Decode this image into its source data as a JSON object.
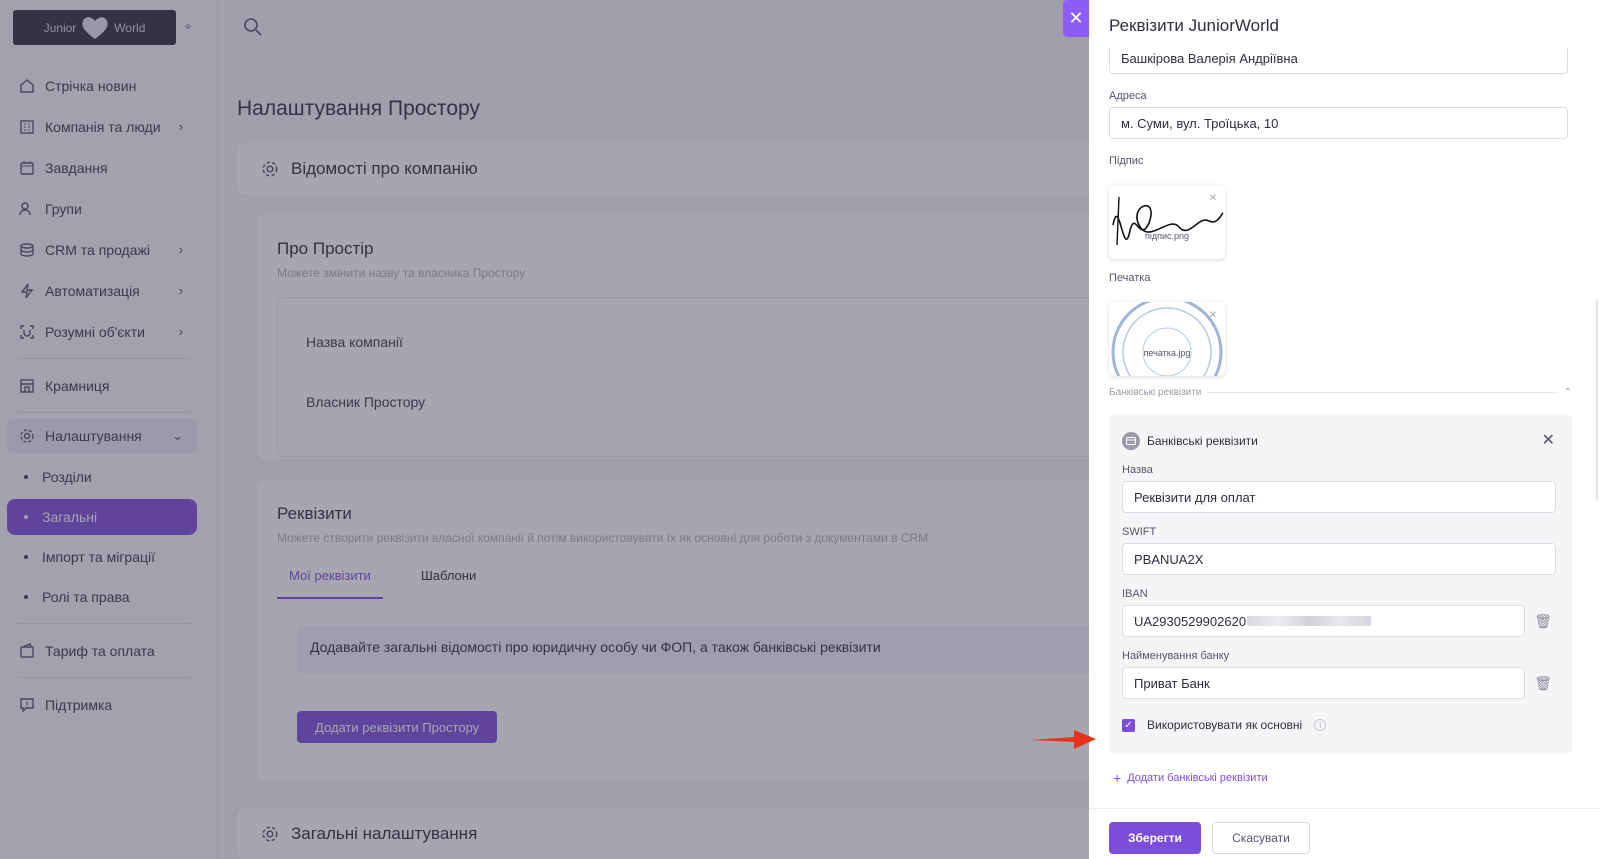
{
  "logo": {
    "left": "Junior",
    "right": "World"
  },
  "sidebar": {
    "items": [
      {
        "label": "Стрічка новин",
        "icon": "home-icon"
      },
      {
        "label": "Компанія та люди",
        "icon": "building-icon",
        "chevron": true
      },
      {
        "label": "Завдання",
        "icon": "calendar-icon"
      },
      {
        "label": "Групи",
        "icon": "users-icon"
      },
      {
        "label": "CRM та продажі",
        "icon": "database-icon",
        "chevron": true
      },
      {
        "label": "Автоматизація",
        "icon": "lightning-icon",
        "chevron": true
      },
      {
        "label": "Розумні об'єкти",
        "icon": "smart-object-icon",
        "chevron": true
      },
      {
        "label": "Крамниця",
        "icon": "store-icon"
      },
      {
        "label": "Налаштування",
        "icon": "gear-icon"
      }
    ],
    "sub_items": [
      "Розділи",
      "Загальні",
      "Імпорт та міграції",
      "Ролі та права"
    ],
    "bottom_items": [
      {
        "label": "Тариф та оплата",
        "icon": "wallet-icon"
      },
      {
        "label": "Підтримка",
        "icon": "support-icon"
      }
    ]
  },
  "main": {
    "page_title": "Налаштування Простору",
    "company_section": "Відомості про компанію",
    "about": {
      "title": "Про Простір",
      "subtitle": "Можете змінити назву та власника Простору",
      "name_label": "Назва компанії",
      "owner_label": "Власник Простору"
    },
    "requisites": {
      "title": "Реквізити",
      "subtitle": "Можете створити реквізити власної компанії й потім використовувати їх як основні для роботи з документами в CRM",
      "tab_mine": "Мої реквізити",
      "tab_templates": "Шаблони",
      "info": "Додавайте загальні відомості про юридичну особу чи ФОП, а також банківські реквізити",
      "add_button": "Додати реквізити Простору"
    },
    "general_section": "Загальні налаштування"
  },
  "drawer": {
    "title": "Реквізити JuniorWorld",
    "person_value": "Башкірова Валерія Андріївна",
    "address_label": "Адреса",
    "address_value": "м. Суми, вул. Троїцька, 10",
    "signature_label": "Підпис",
    "signature_file": "підпис.png",
    "stamp_label": "Печатка",
    "stamp_file": "печатка.jpg",
    "bank_section": "Банківські реквізити",
    "bank": {
      "header": "Банківські реквізити",
      "name_label": "Назва",
      "name_value": "Реквізити для оплат",
      "swift_label": "SWIFT",
      "swift_value": "PBANUA2X",
      "iban_label": "IBAN",
      "iban_value": "UA2930529902620",
      "bank_name_label": "Найменування банку",
      "bank_name_value": "Приват Банк",
      "use_default_label": "Використовувати як основні"
    },
    "add_bank_link": "Додати банківські реквізити",
    "save_button": "Зберегти",
    "cancel_button": "Скасувати"
  },
  "colors": {
    "accent": "#7c4ddb",
    "arrow": "#e8341c"
  }
}
